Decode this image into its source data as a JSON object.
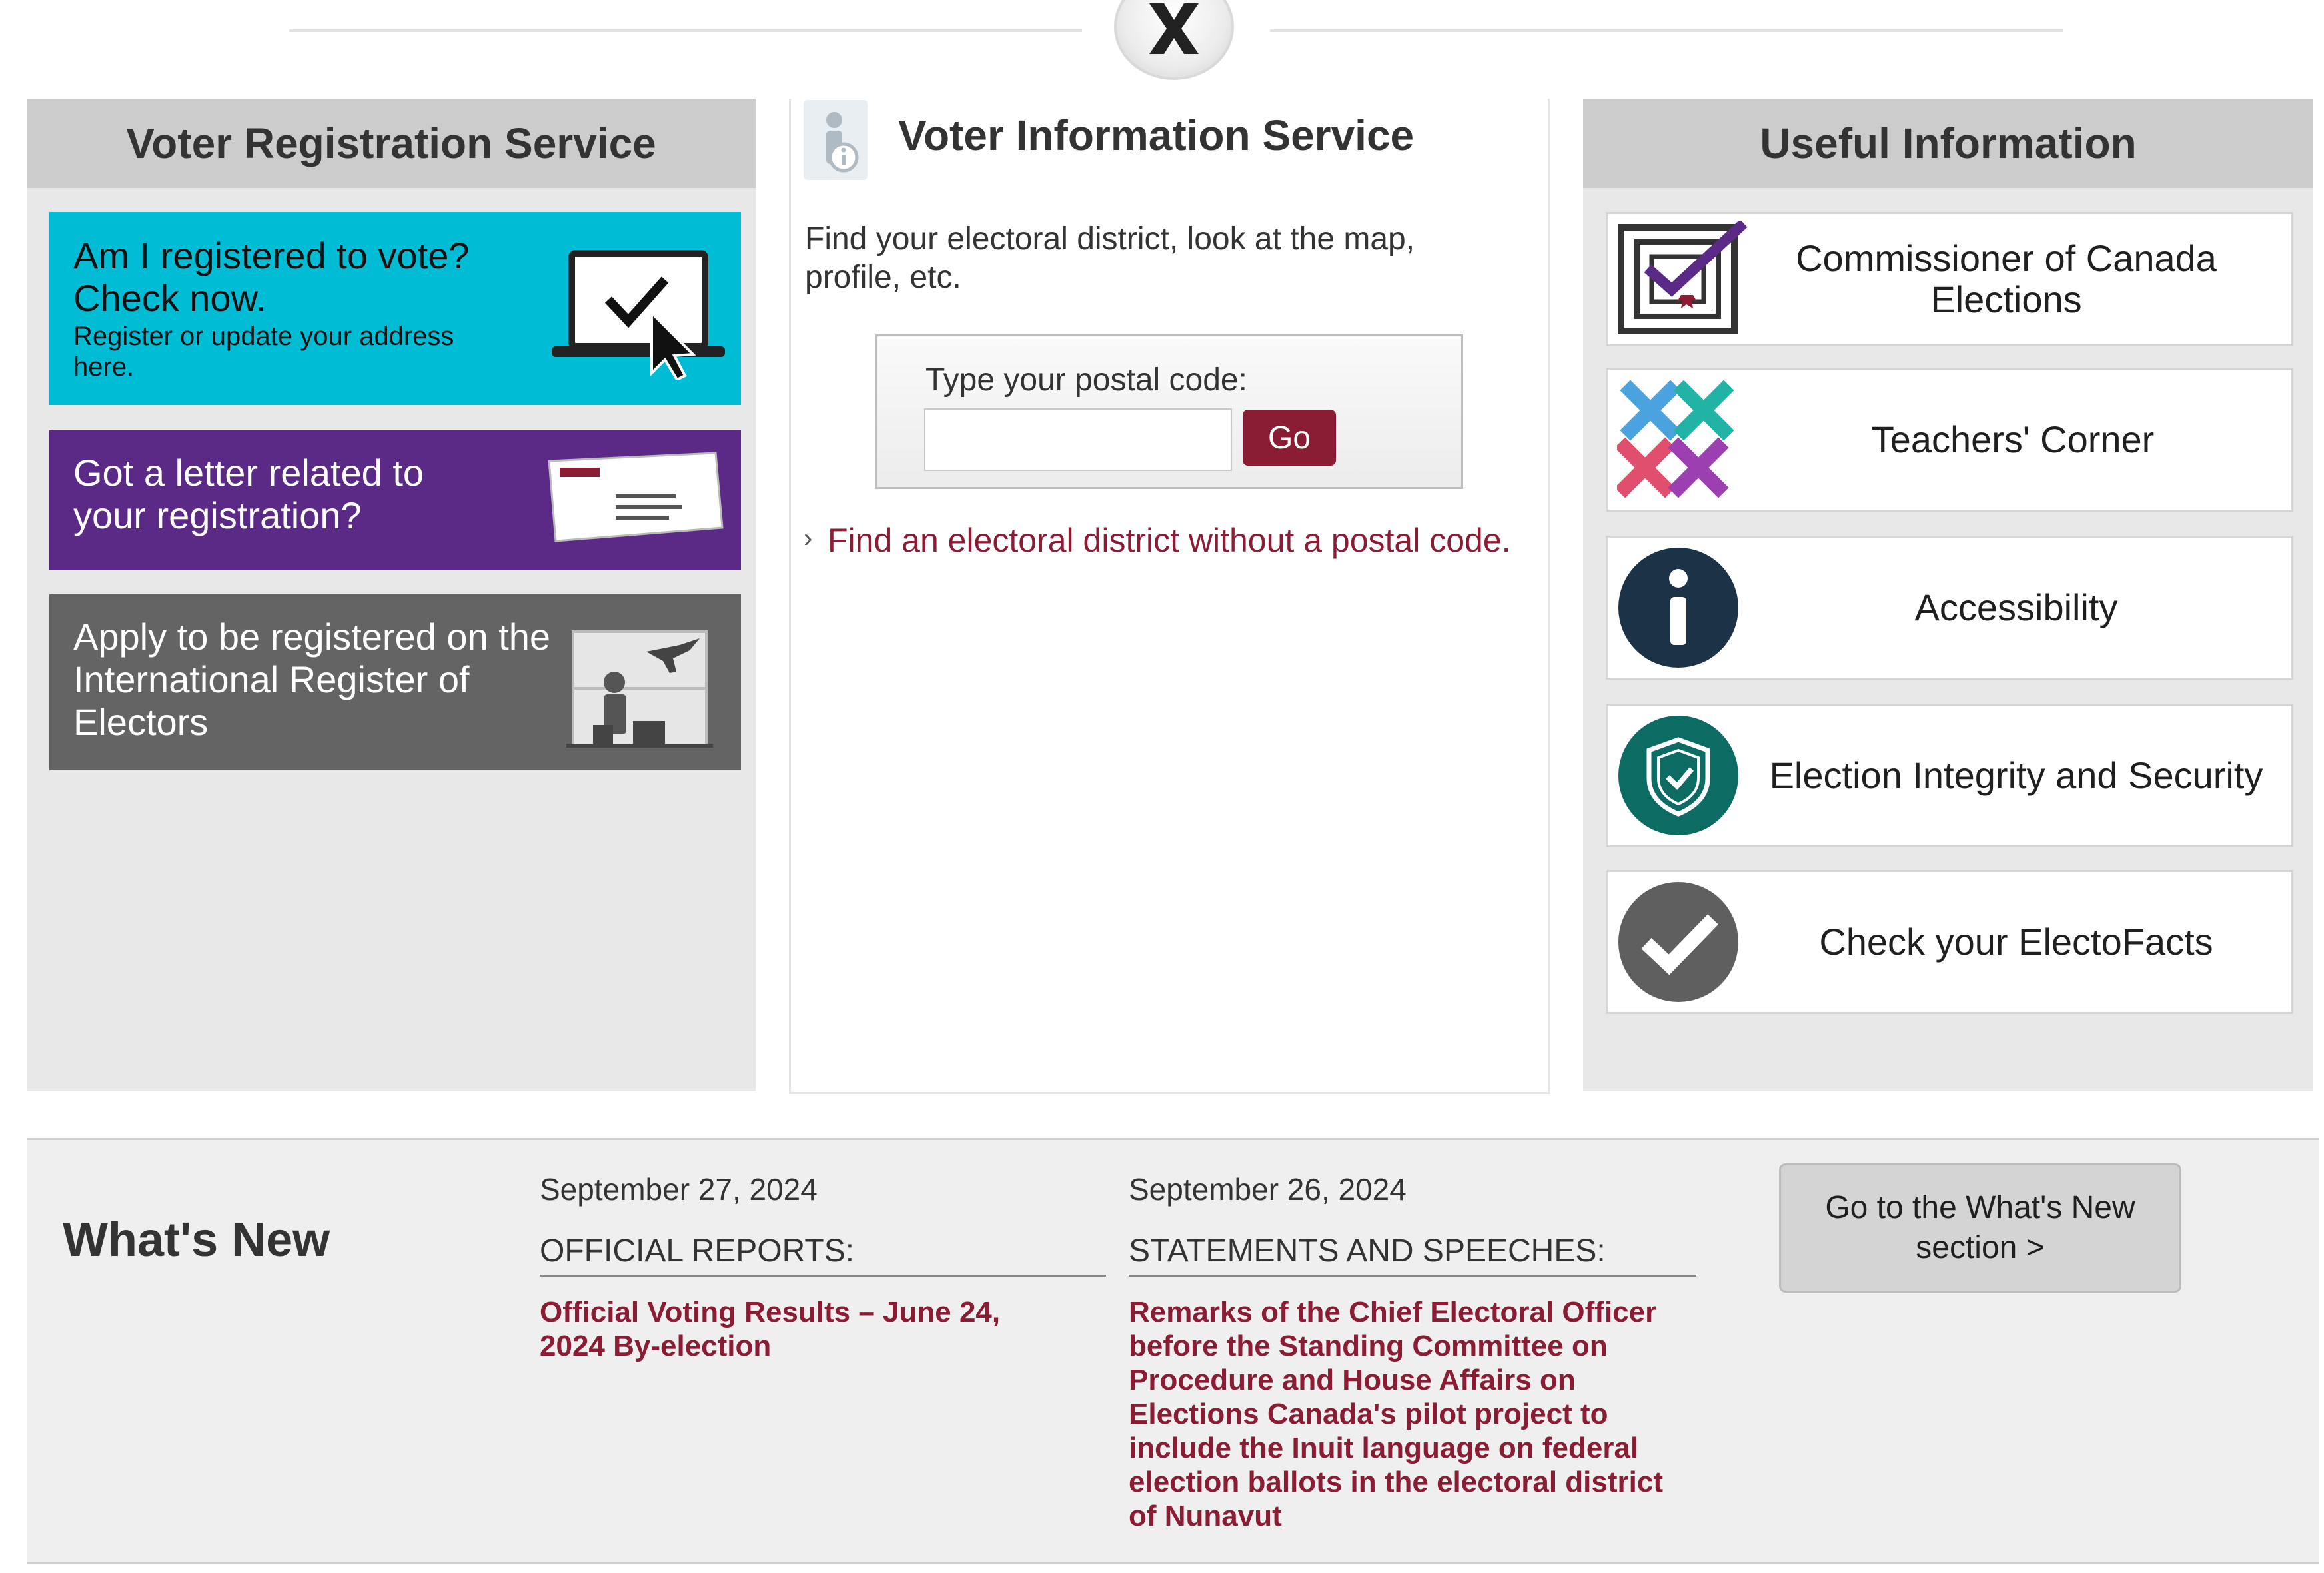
{
  "registration": {
    "title": "Voter Registration Service",
    "card_check": {
      "title": "Am I registered to vote? Check now.",
      "subtitle": "Register or update your address here."
    },
    "card_letter": {
      "title": "Got a letter related to your registration?"
    },
    "card_international": {
      "title": "Apply to be registered on the International Register of Electors"
    },
    "colors": {
      "check": "#00bcd4",
      "letter": "#5b2a86",
      "international": "#646464"
    }
  },
  "voter_info": {
    "title": "Voter Information Service",
    "description": "Find your electoral district, look at the map, profile, etc.",
    "postal_label": "Type your postal code:",
    "postal_value": "",
    "go_label": "Go",
    "link_marker": "›",
    "link_text": "Find an electoral district without a postal code."
  },
  "useful": {
    "title": "Useful Information",
    "items": [
      {
        "label": "Commissioner of Canada Elections",
        "icon": "commissioner-logo-icon"
      },
      {
        "label": "Teachers' Corner",
        "icon": "teachers-x-icon"
      },
      {
        "label": "Accessibility",
        "icon": "info-circle-icon"
      },
      {
        "label": "Election Integrity and Security",
        "icon": "shield-check-icon"
      },
      {
        "label": "Check your ElectoFacts",
        "icon": "checkmark-circle-icon"
      }
    ]
  },
  "whats_new": {
    "title": "What's New",
    "entries": [
      {
        "date": "September 27, 2024",
        "category": "OFFICIAL REPORTS:",
        "link": "Official Voting Results – June 24, 2024 By-election"
      },
      {
        "date": "September 26, 2024",
        "category": "STATEMENTS AND SPEECHES:",
        "link": "Remarks of the Chief Electoral Officer before the Standing Committee on Procedure and House Affairs on Elections Canada's pilot project to include the Inuit language on federal election ballots in the electoral district of Nunavut"
      }
    ],
    "button_label": "Go to the What's New section >"
  },
  "colors": {
    "brand_red": "#8a1c34",
    "accessibility_navy": "#1c3347",
    "integrity_teal": "#0c6b63",
    "electofacts_gray": "#5f5f5f"
  }
}
